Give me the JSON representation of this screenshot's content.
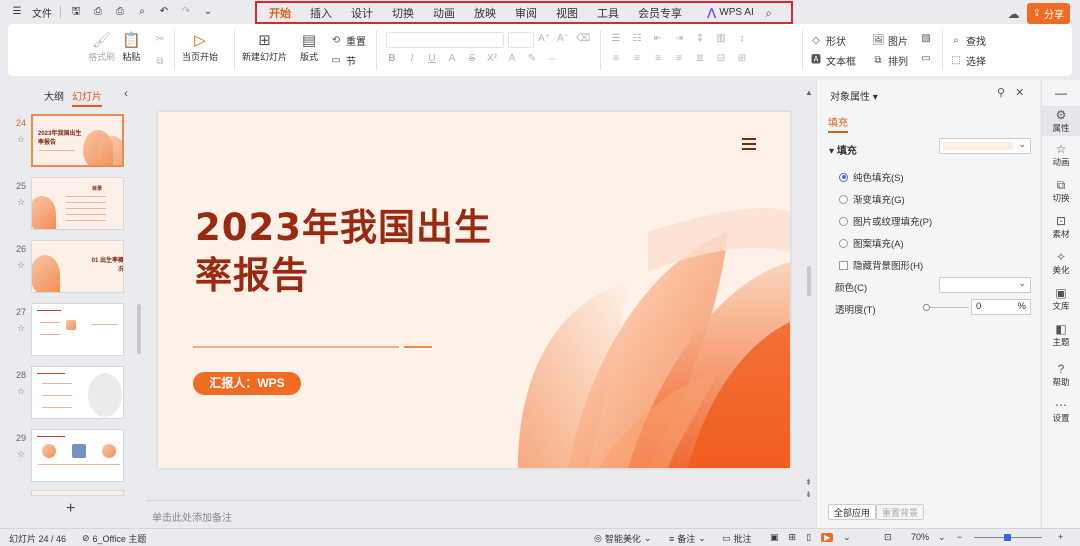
{
  "titlebar": {
    "file_label": "文件",
    "tabs": [
      "开始",
      "插入",
      "设计",
      "切换",
      "动画",
      "放映",
      "审阅",
      "视图",
      "工具",
      "会员专享"
    ],
    "active_tab": "开始",
    "wps_ai_label": "WPS AI",
    "share_label": "分享"
  },
  "ribbon": {
    "format_painter": "格式刷",
    "paste": "粘贴",
    "from_current": "当页开始",
    "new_slide": "新建幻灯片",
    "layout": "版式",
    "reset": "重置",
    "section": "节",
    "shape": "形状",
    "picture": "图片",
    "textbox": "文本框",
    "arrange": "排列",
    "find": "查找",
    "select": "选择"
  },
  "left_panel": {
    "tab_outline": "大纲",
    "tab_slides": "幻灯片",
    "slides": [
      {
        "num": "24",
        "active": true,
        "title": "2023年我国出生率报告"
      },
      {
        "num": "25",
        "active": false,
        "title": "目录"
      },
      {
        "num": "26",
        "active": false,
        "title": "01 出生率概况"
      },
      {
        "num": "27",
        "active": false,
        "title": ""
      },
      {
        "num": "28",
        "active": false,
        "title": ""
      },
      {
        "num": "29",
        "active": false,
        "title": ""
      }
    ]
  },
  "slide": {
    "title_line1": "2023年我国出生",
    "title_line2": "率报告",
    "reporter": "汇报人：WPS"
  },
  "notes_placeholder": "单击此处添加备注",
  "properties": {
    "panel_title": "对象属性",
    "subtab": "填充",
    "section": "填充",
    "fill_options": [
      "纯色填充(S)",
      "渐变填充(G)",
      "图片或纹理填充(P)",
      "图案填充(A)"
    ],
    "selected_fill": "纯色填充(S)",
    "hide_bg_label": "隐藏背景图形(H)",
    "color_label": "颜色(C)",
    "transparency_label": "透明度(T)",
    "transparency_value": "0",
    "transparency_unit": "%",
    "apply_all": "全部应用",
    "reset_bg": "重置背景",
    "fill_color": "#fdeee2"
  },
  "right_bar": [
    {
      "label": "属性",
      "icon": "properties-icon"
    },
    {
      "label": "动画",
      "icon": "animation-icon"
    },
    {
      "label": "切换",
      "icon": "transition-icon"
    },
    {
      "label": "素材",
      "icon": "material-icon"
    },
    {
      "label": "美化",
      "icon": "beautify-icon"
    },
    {
      "label": "文库",
      "icon": "library-icon"
    },
    {
      "label": "主题",
      "icon": "theme-icon"
    },
    {
      "label": "帮助",
      "icon": "help-icon"
    },
    {
      "label": "设置",
      "icon": "settings-icon"
    }
  ],
  "statusbar": {
    "slide_counter": "幻灯片 24 / 46",
    "theme": "6_Office 主题",
    "smart_beautify": "智能美化",
    "notes": "备注",
    "comments": "批注",
    "zoom": "70%"
  },
  "colors": {
    "accent": "#e05d16",
    "slide_title": "#9a2a0f",
    "reporter_bg": "#f06a22",
    "highlight_box": "#e0242b"
  }
}
